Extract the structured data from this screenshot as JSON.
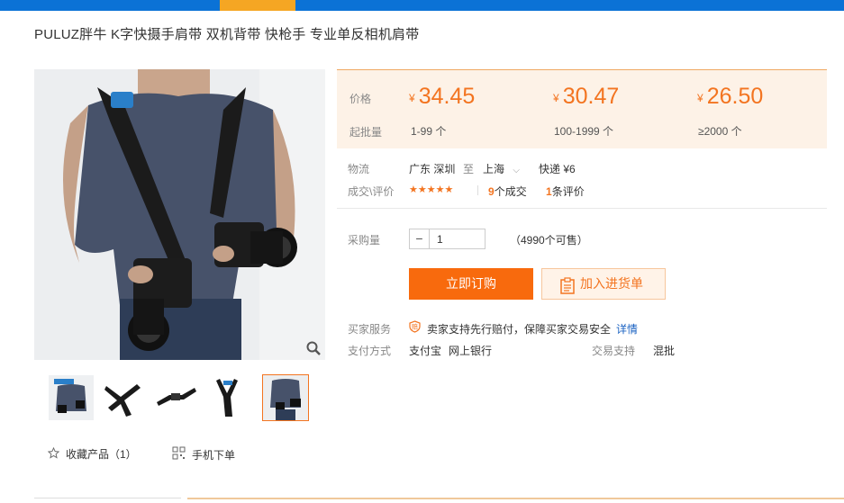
{
  "header": {
    "title": "PULUZ胖牛 K字快摄手肩带 双机背带 快枪手 专业单反相机肩带",
    "colors": {
      "bar": "#0b72d6",
      "tab_accent": "#f5a623"
    }
  },
  "price_box": {
    "price_label": "价格",
    "moq_label": "起批量",
    "currency": "¥",
    "tiers": [
      {
        "price": "34.45",
        "qty": "1-99 个"
      },
      {
        "price": "30.47",
        "qty": "100-1999 个"
      },
      {
        "price": "26.50",
        "qty": "≥2000 个"
      }
    ],
    "accent": "#f37420"
  },
  "logistics": {
    "label": "物流",
    "from": "广东 深圳",
    "to_word": "至",
    "to": "上海",
    "method": "快递 ¥6"
  },
  "deals": {
    "label": "成交\\评价",
    "stars": "★★★★★",
    "rating": 5,
    "deal_count": "9",
    "deal_text": "个成交",
    "review_count": "1",
    "review_text": "条评价"
  },
  "purchase": {
    "label": "采购量",
    "minus": "−",
    "quantity": "1",
    "available": "（4990个可售）"
  },
  "buttons": {
    "buy": "立即订购",
    "cart": "加入进货单"
  },
  "services": {
    "buyer_label": "买家服务",
    "buyer_text": "卖家支持先行赔付，保障买家交易安全",
    "detail_link": "详情",
    "payment_label": "支付方式",
    "payment_methods": [
      "支付宝",
      "网上银行"
    ],
    "trade_label": "交易支持",
    "trade_value": "混批"
  },
  "gallery": {
    "thumb_count": 5,
    "active_index": 4
  },
  "footer_actions": {
    "favorite": "收藏产品（1）",
    "mobile": "手机下单"
  }
}
